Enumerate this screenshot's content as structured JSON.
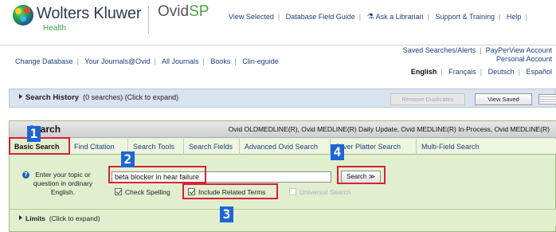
{
  "brand": {
    "name": "Wolters Kluwer",
    "sub": "Health",
    "product_prefix": "Ovid",
    "product_suffix": "SP"
  },
  "toplinks": [
    "View Selected",
    "Database Field Guide",
    "Ask a Librarian",
    "Support & Training",
    "Help"
  ],
  "sublinks_left": [
    "Change Database",
    "Your Journals@Ovid",
    "All Journals",
    "Books",
    "Clin-eguide"
  ],
  "sublinks_right": {
    "row1": [
      "Saved Searches/Alerts",
      "PayPerView Account"
    ],
    "row2": "Personal Account",
    "languages": [
      "English",
      "Français",
      "Deutsch",
      "Español"
    ],
    "active_language": "English"
  },
  "history": {
    "label": "Search History",
    "detail": "(0 searches) (Click to expand)",
    "remove_duplicates": "Remove Duplicates",
    "view_saved": "View Saved"
  },
  "panel": {
    "title": "Search",
    "databases": "Ovid OLDMEDLINE(R), Ovid MEDLINE(R) Daily Update, Ovid MEDLINE(R) In-Process, Ovid MEDLINE(R)",
    "tabs": [
      "Basic Search",
      "Find Citation",
      "Search Tools",
      "Search Fields",
      "Advanced Ovid Search",
      "Silver Platter Search",
      "Multi-Field Search"
    ],
    "topic_label": "Enter your topic or question in ordinary English.",
    "search_value": "beta blocker in hear failure",
    "search_button": "Search ≫",
    "checks": [
      {
        "label": "Check Spelling",
        "checked": true,
        "disabled": false
      },
      {
        "label": "Include Related Terms",
        "checked": true,
        "disabled": false
      },
      {
        "label": "Universal Search",
        "checked": false,
        "disabled": true
      }
    ],
    "limits_label": "Limits",
    "limits_detail": "(Click to expand)"
  },
  "markers": [
    "1",
    "2",
    "3",
    "4"
  ],
  "colors": {
    "accent_blue": "#1e66d6",
    "highlight_red": "#d6213a",
    "panel_green": "#e1efcf",
    "link_blue": "#1f3d7a"
  }
}
